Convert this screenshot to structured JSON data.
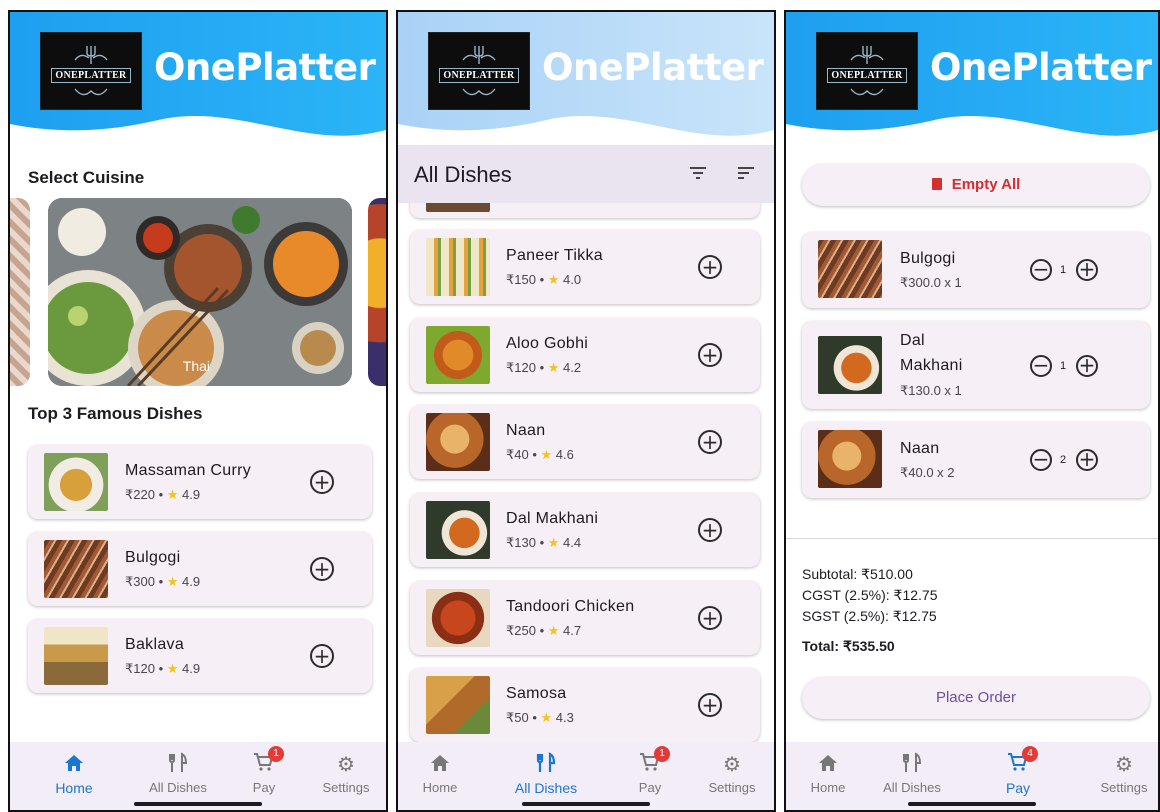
{
  "app": {
    "name": "OnePlatter",
    "logo_text": "ONEPLATTER"
  },
  "colors": {
    "header_blue": "#1aa3f0",
    "header_light": "#b9dcf7",
    "active": "#1976d2",
    "badge": "#e53935",
    "star": "#f6c21a",
    "card": "#f6eff6",
    "accent_text": "#6a4fa3",
    "danger": "#d32f2f"
  },
  "nav": {
    "items": [
      {
        "label": "Home",
        "icon": "home-icon"
      },
      {
        "label": "All Dishes",
        "icon": "restaurant-icon"
      },
      {
        "label": "Pay",
        "icon": "cart-icon"
      },
      {
        "label": "Settings",
        "icon": "gear-icon"
      }
    ]
  },
  "home": {
    "select_cuisine": "Select Cuisine",
    "featured_cuisine": "Thai",
    "top_title": "Top 3 Famous Dishes",
    "dishes": [
      {
        "name": "Massaman Curry",
        "meta": "₹220 • ",
        "rating": "4.9"
      },
      {
        "name": "Bulgogi",
        "meta": "₹300 • ",
        "rating": "4.9"
      },
      {
        "name": "Baklava",
        "meta": "₹120 • ",
        "rating": "4.9"
      }
    ],
    "cart_badge": "1"
  },
  "all_dishes": {
    "title": "All Dishes",
    "dishes": [
      {
        "name": "Paneer Tikka",
        "meta": "₹150 • ",
        "rating": "4.0"
      },
      {
        "name": "Aloo Gobhi",
        "meta": "₹120 • ",
        "rating": "4.2"
      },
      {
        "name": "Naan",
        "meta": "₹40 • ",
        "rating": "4.6"
      },
      {
        "name": "Dal Makhani",
        "meta": "₹130 • ",
        "rating": "4.4"
      },
      {
        "name": "Tandoori Chicken",
        "meta": "₹250 • ",
        "rating": "4.7"
      },
      {
        "name": "Samosa",
        "meta": "₹50 • ",
        "rating": "4.3"
      }
    ],
    "cart_badge": "1"
  },
  "pay": {
    "empty_all": "Empty All",
    "items": [
      {
        "name": "Bulgogi",
        "price": "₹300.0 x 1",
        "qty": "1"
      },
      {
        "name_line1": "Dal",
        "name_line2": "Makhani",
        "price": "₹130.0 x 1",
        "qty": "1"
      },
      {
        "name": "Naan",
        "price": "₹40.0 x 2",
        "qty": "2"
      }
    ],
    "subtotal": "Subtotal: ₹510.00",
    "cgst": "CGST (2.5%): ₹12.75",
    "sgst": "SGST (2.5%): ₹12.75",
    "total": "Total: ₹535.50",
    "place_order": "Place Order",
    "cart_badge": "4"
  }
}
